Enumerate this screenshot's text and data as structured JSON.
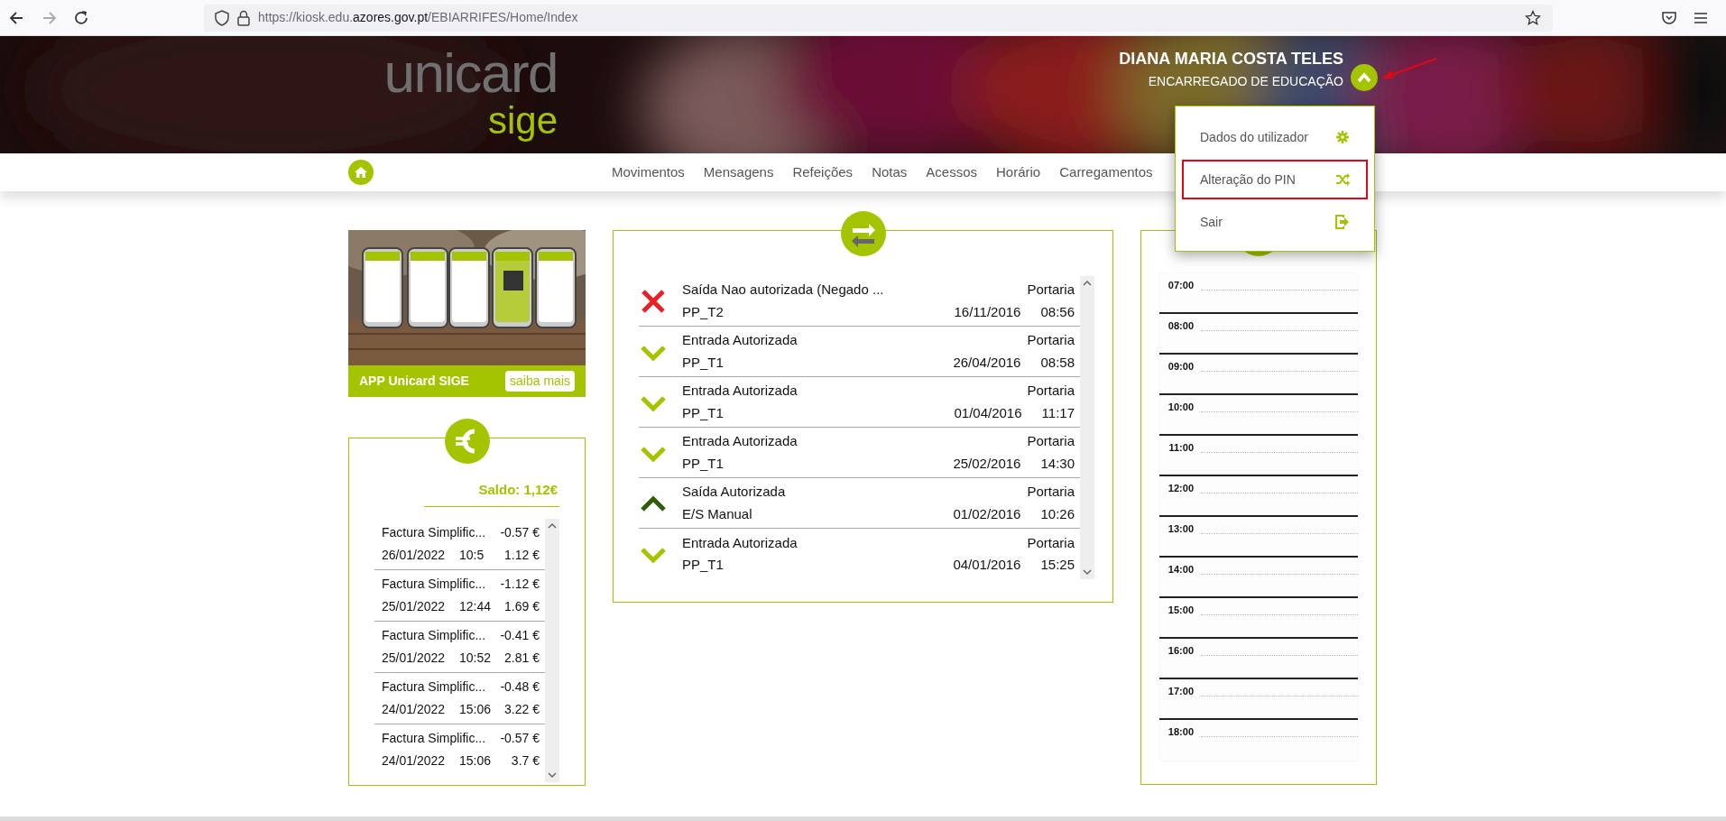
{
  "browser": {
    "url_start": "https://kiosk.edu.",
    "url_domain": "azores.gov.pt",
    "url_end": "/EBIARRIFES/Home/Index"
  },
  "header": {
    "logo_main": "unicard",
    "logo_sub": "sige",
    "user_name": "DIANA MARIA COSTA TELES",
    "user_role": "ENCARREGADO DE EDUCAÇÃO",
    "menu_expanded": true
  },
  "user_menu": [
    {
      "kind": "settings",
      "label": "Dados do utilizador",
      "highlighted": false
    },
    {
      "kind": "pin",
      "label": "Alteração do PIN",
      "highlighted": true
    },
    {
      "kind": "logout",
      "label": "Sair",
      "highlighted": false
    }
  ],
  "nav": [
    "Movimentos",
    "Mensagens",
    "Refeições",
    "Notas",
    "Acessos",
    "Horário",
    "Carregamentos"
  ],
  "app_promo": {
    "title": "APP Unicard SIGE",
    "button": "saiba mais"
  },
  "balance": {
    "label": "Saldo: 1,12€",
    "transactions": [
      {
        "description": "Factura Simplific...",
        "amount": "-0.57 €",
        "date": "26/01/2022",
        "time": "10:5",
        "balance": "1.12 €"
      },
      {
        "description": "Factura Simplific...",
        "amount": "-1.12 €",
        "date": "25/01/2022",
        "time": "12:44",
        "balance": "1.69 €"
      },
      {
        "description": "Factura Simplific...",
        "amount": "-0.41 €",
        "date": "25/01/2022",
        "time": "10:52",
        "balance": "2.81 €"
      },
      {
        "description": "Factura Simplific...",
        "amount": "-0.48 €",
        "date": "24/01/2022",
        "time": "15:06",
        "balance": "3.22 €"
      },
      {
        "description": "Factura Simplific...",
        "amount": "-0.57 €",
        "date": "24/01/2022",
        "time": "15:06",
        "balance": "3.7 €"
      }
    ]
  },
  "movements": [
    {
      "kind": "denied",
      "title": "Saída Nao autorizada (Negado ...",
      "device": "PP_T2",
      "location": "Portaria",
      "date": "16/11/2016",
      "time": "08:56"
    },
    {
      "kind": "entry",
      "title": "Entrada Autorizada",
      "device": "PP_T1",
      "location": "Portaria",
      "date": "26/04/2016",
      "time": "08:58"
    },
    {
      "kind": "entry",
      "title": "Entrada Autorizada",
      "device": "PP_T1",
      "location": "Portaria",
      "date": "01/04/2016",
      "time": "11:17"
    },
    {
      "kind": "entry",
      "title": "Entrada Autorizada",
      "device": "PP_T1",
      "location": "Portaria",
      "date": "25/02/2016",
      "time": "14:30"
    },
    {
      "kind": "exit",
      "title": "Saída Autorizada",
      "device": "E/S Manual",
      "location": "Portaria",
      "date": "01/02/2016",
      "time": "10:26"
    },
    {
      "kind": "entry",
      "title": "Entrada Autorizada",
      "device": "PP_T1",
      "location": "Portaria",
      "date": "04/01/2016",
      "time": "15:25"
    }
  ],
  "schedule": {
    "hours": [
      "07:00",
      "08:00",
      "09:00",
      "10:00",
      "11:00",
      "12:00",
      "13:00",
      "14:00",
      "15:00",
      "16:00",
      "17:00",
      "18:00"
    ]
  }
}
